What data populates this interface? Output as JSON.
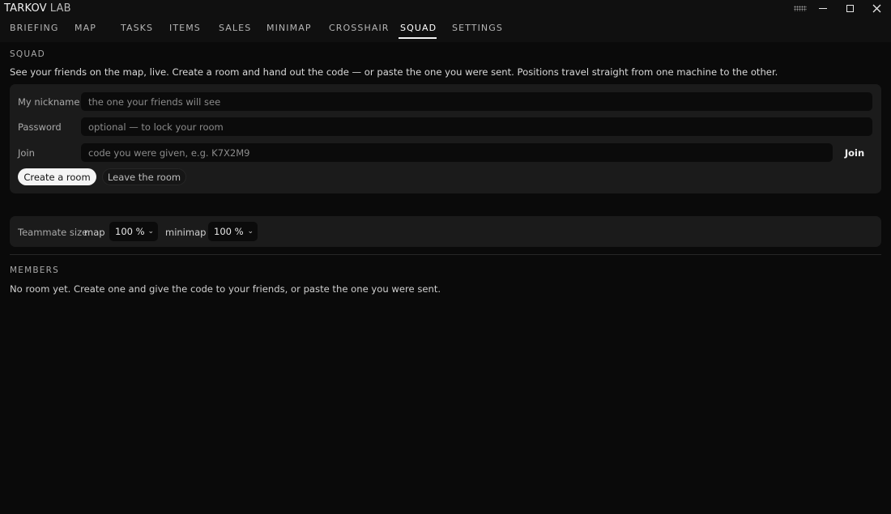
{
  "app": {
    "title": "TARKOV",
    "title_suffix": "LAB"
  },
  "window_controls": {
    "grip_icon": "drag-grip-icon",
    "minimize_icon": "minimize-icon",
    "maximize_icon": "maximize-icon",
    "close_icon": "close-icon"
  },
  "tabs": [
    {
      "label": "BRIEFING",
      "active": false
    },
    {
      "label": "MAP",
      "active": false
    },
    {
      "label": "TASKS",
      "active": false
    },
    {
      "label": "ITEMS",
      "active": false
    },
    {
      "label": "SALES",
      "active": false
    },
    {
      "label": "MINIMAP",
      "active": false
    },
    {
      "label": "CROSSHAIR",
      "active": false
    },
    {
      "label": "SQUAD",
      "active": true
    },
    {
      "label": "SETTINGS",
      "active": false
    }
  ],
  "squad": {
    "section_label": "SQUAD",
    "description": "See your friends on the map, live. Create a room and hand out the code — or paste the one you were sent. Positions travel straight from one machine to the other.",
    "nickname": {
      "label": "My nickname",
      "placeholder": "the one your friends will see",
      "value": ""
    },
    "password": {
      "label": "Password",
      "placeholder": "optional — to lock your room",
      "value": ""
    },
    "join": {
      "label": "Join",
      "placeholder": "code you were given, e.g. K7X2M9",
      "value": "",
      "button_label": "Join"
    },
    "create_button": "Create a room",
    "leave_button": "Leave the room"
  },
  "teammate_size": {
    "label": "Teammate size",
    "map_label": "map",
    "map_value": "100 %",
    "minimap_label": "minimap",
    "minimap_value": "100 %"
  },
  "members": {
    "section_label": "MEMBERS",
    "empty_text": "No room yet. Create one and give the code to your friends, or paste the one you were sent."
  }
}
